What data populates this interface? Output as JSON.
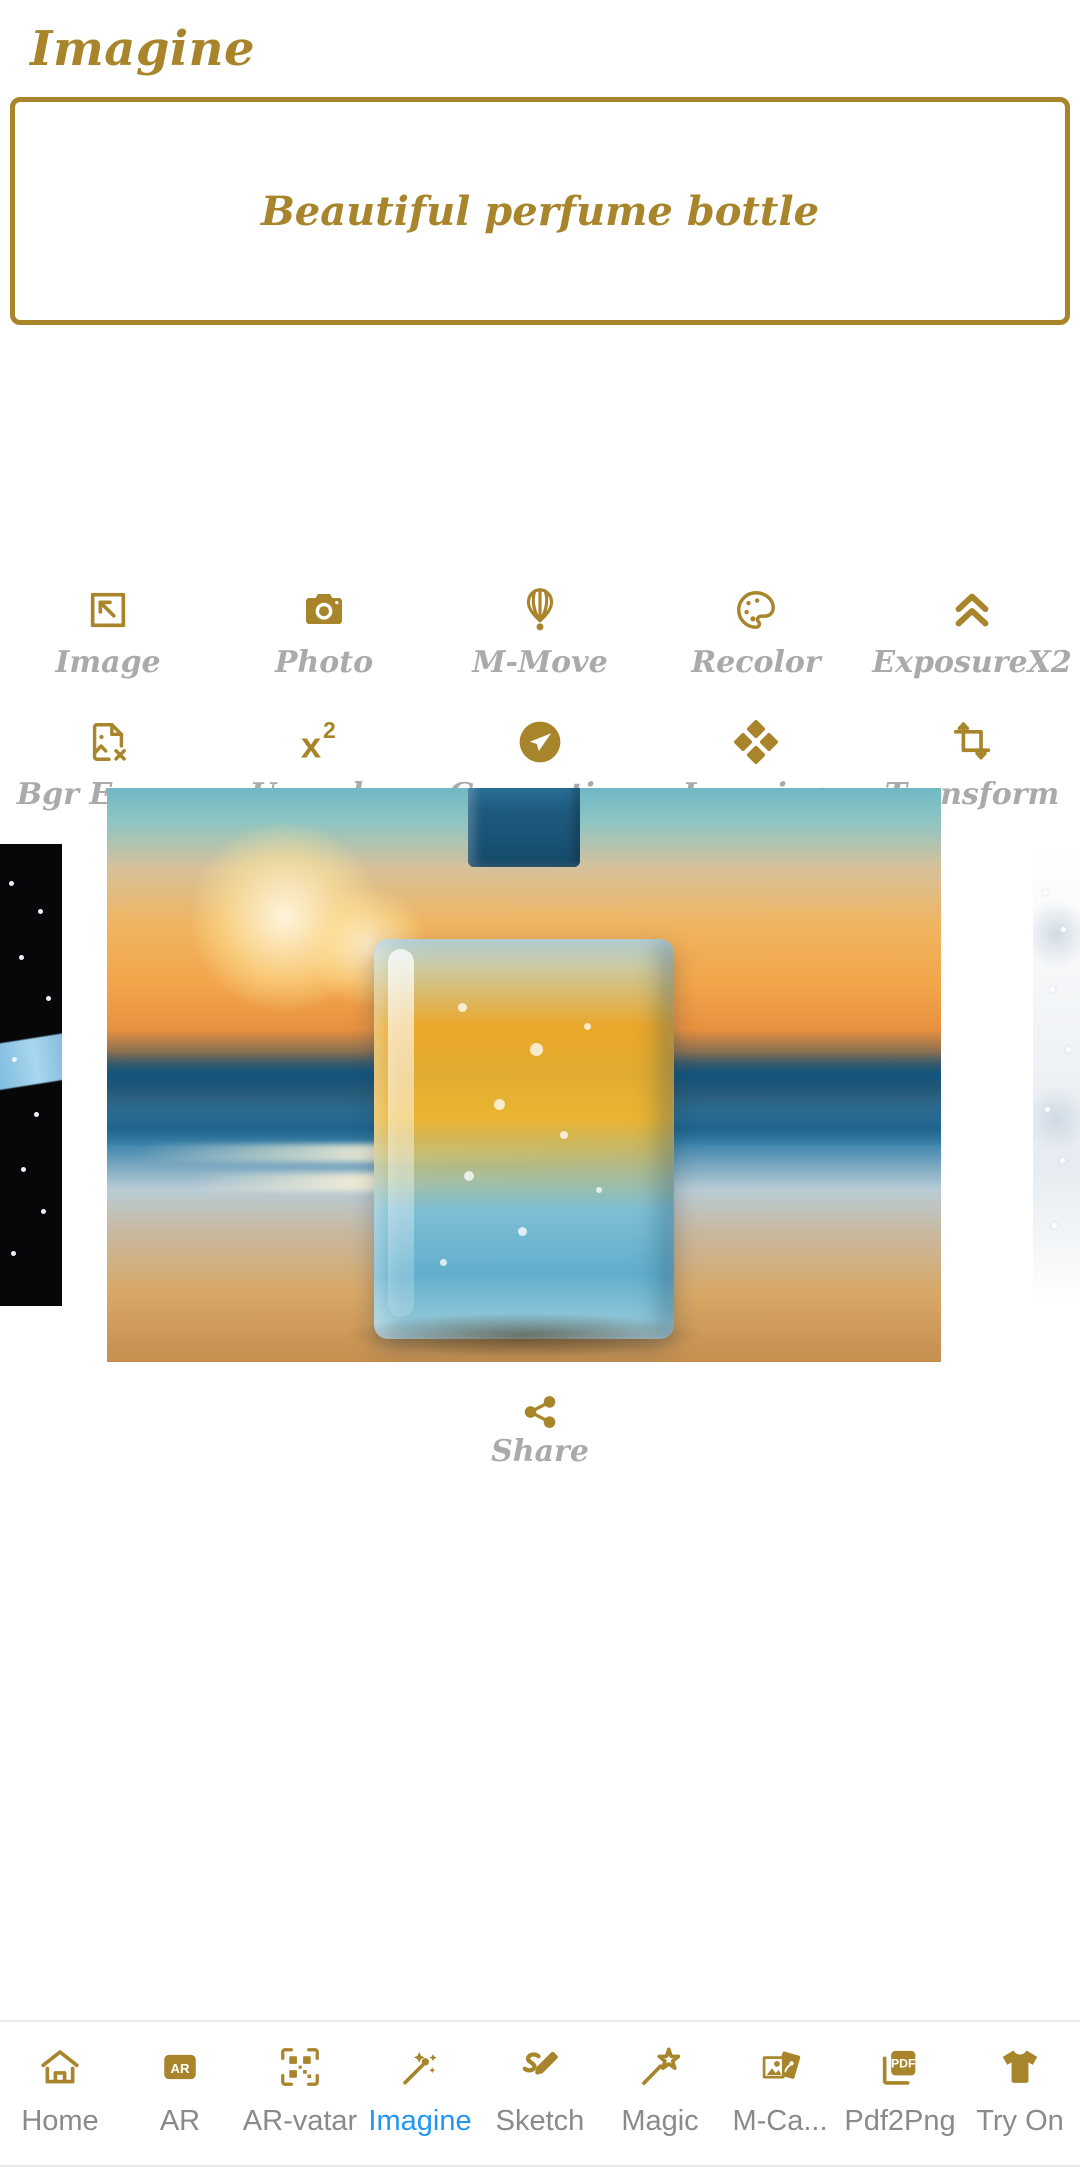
{
  "header": {
    "title": "Imagine"
  },
  "prompt": {
    "value": "Beautiful perfume bottle",
    "placeholder": "Beautiful perfume bottle"
  },
  "colors": {
    "gold": "#a8842b",
    "label_gray": "#aaaaaa",
    "nav_label_gray": "#8a8a8a",
    "active_blue": "#2196f3",
    "page_bg": "#ffffff"
  },
  "tools": {
    "row1": [
      {
        "label": "Image",
        "icon": "image-select-icon"
      },
      {
        "label": "Photo",
        "icon": "camera-icon"
      },
      {
        "label": "M-Move",
        "icon": "hot-air-balloon-icon"
      },
      {
        "label": "Recolor",
        "icon": "palette-icon"
      },
      {
        "label": "ExposureX2",
        "icon": "double-chevron-up-icon"
      }
    ],
    "row2": [
      {
        "label": "Bgr Eraser",
        "icon": "image-remove-icon"
      },
      {
        "label": "Upscaler",
        "icon": "x-squared-icon"
      },
      {
        "label": "Generative",
        "icon": "send-circle-icon"
      },
      {
        "label": "Layering",
        "icon": "four-diamonds-icon"
      },
      {
        "label": "Transform",
        "icon": "crop-transform-icon"
      }
    ]
  },
  "carousel": {
    "slides": [
      {
        "position": "left-partial",
        "alt": "dark night image with blue streak"
      },
      {
        "position": "center-active",
        "alt": "blue and amber glass perfume bottle on sunset beach"
      },
      {
        "position": "right-partial",
        "alt": "bright white misty image"
      }
    ]
  },
  "share": {
    "label": "Share",
    "icon": "share-nodes-icon"
  },
  "bottom_nav": {
    "active_index": 3,
    "items": [
      {
        "label": "Home",
        "icon": "home-icon"
      },
      {
        "label": "AR",
        "icon": "ar-badge-icon"
      },
      {
        "label": "AR-vatar",
        "icon": "qr-code-icon"
      },
      {
        "label": "Imagine",
        "icon": "magic-sparkle-wand-icon"
      },
      {
        "label": "Sketch",
        "icon": "s-pencil-icon"
      },
      {
        "label": "Magic",
        "icon": "star-wand-icon"
      },
      {
        "label": "M-Ca...",
        "icon": "photo-stack-icon"
      },
      {
        "label": "Pdf2Png",
        "icon": "pdf-icon"
      },
      {
        "label": "Try On",
        "icon": "tshirt-icon"
      }
    ]
  }
}
